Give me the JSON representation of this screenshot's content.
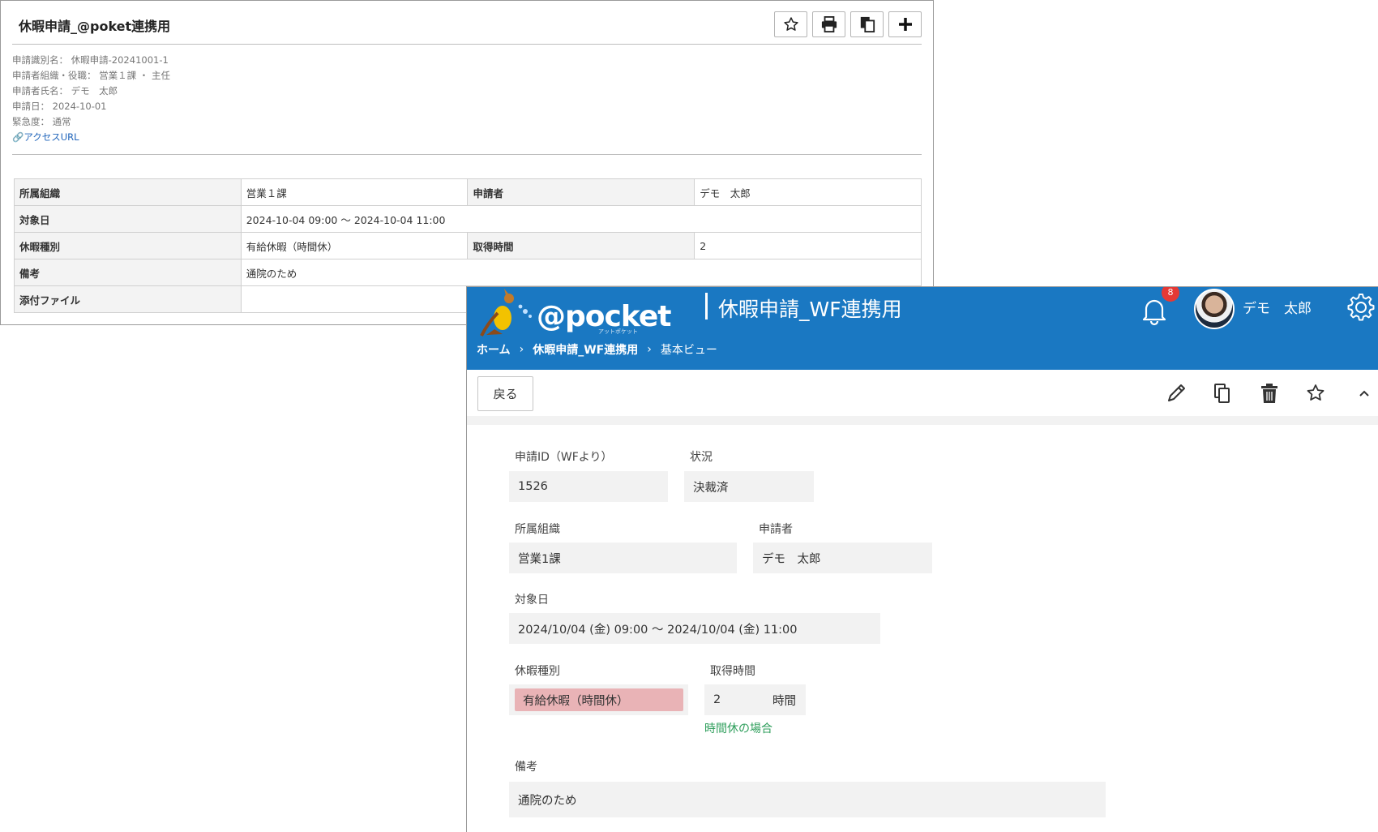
{
  "workflow": {
    "title": "休暇申請_@poket連携用",
    "toolbar_icons": [
      "star-icon",
      "print-icon",
      "copy-icon",
      "plus-icon"
    ],
    "meta": {
      "request_id": "申請識別名： 休暇申請-20241001-1",
      "org_role": "申請者組織・役職： 営業１課 ・ 主任",
      "applicant_name": "申請者氏名： デモ　太郎",
      "request_date": "申請日： 2024-10-01",
      "urgency": "緊急度： 通常",
      "access_url": "アクセスURL"
    },
    "table": {
      "org_label": "所属組織",
      "org_value": "営業１課",
      "applicant_label": "申請者",
      "applicant_value": "デモ　太郎",
      "date_label": "対象日",
      "date_value": "2024-10-04 09:00 ～ 2024-10-04 11:00",
      "type_label": "休暇種別",
      "type_value": "有給休暇（時間休）",
      "hours_label": "取得時間",
      "hours_value": "2",
      "remarks_label": "備考",
      "remarks_value": "通院のため",
      "attachment_label": "添付ファイル",
      "attachment_value": ""
    }
  },
  "pocket": {
    "logo_text": "@pocket",
    "logo_sub": "アットポケット",
    "title": "休暇申請_WF連携用",
    "notification_count": "8",
    "username": "デモ　太郎",
    "breadcrumb": {
      "home": "ホーム",
      "app": "休暇申請_WF連携用",
      "view": "基本ビュー"
    },
    "back_label": "戻る",
    "form": {
      "req_id_label": "申請ID（WFより）",
      "req_id_value": "1526",
      "status_label": "状況",
      "status_value": "決裁済",
      "org_label": "所属組織",
      "org_value": "営業1課",
      "applicant_label": "申請者",
      "applicant_value": "デモ　太郎",
      "date_label": "対象日",
      "date_value": "2024/10/04 (金) 09:00 ～ 2024/10/04 (金) 11:00",
      "type_label": "休暇種別",
      "type_value": "有給休暇（時間休）",
      "hours_label": "取得時間",
      "hours_value": "2",
      "hours_unit": "時間",
      "hours_hint": "時間休の場合",
      "remarks_label": "備考",
      "remarks_value": "通院のため"
    },
    "colors": {
      "header": "#1a78c2",
      "badge": "#e53935",
      "highlight": "#e9b3b6",
      "hint": "#2e9e5b"
    }
  }
}
